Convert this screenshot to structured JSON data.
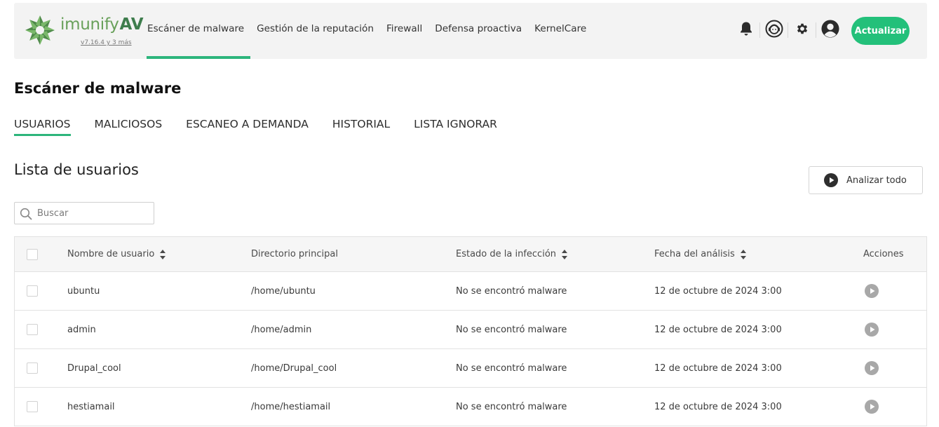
{
  "header": {
    "logo_name": "imunify",
    "logo_av": "AV",
    "version": "v7.16.4 y 3 más",
    "nav": [
      {
        "label": "Escáner de malware",
        "active": true
      },
      {
        "label": "Gestión de la reputación",
        "active": false
      },
      {
        "label": "Firewall",
        "active": false
      },
      {
        "label": "Defensa proactiva",
        "active": false
      },
      {
        "label": "KernelCare",
        "active": false
      }
    ],
    "icons": [
      "bell-icon",
      "support-agent-icon",
      "gear-icon",
      "user-avatar-icon"
    ],
    "upgrade_label": "Actualizar"
  },
  "page": {
    "title": "Escáner de malware",
    "tabs": [
      {
        "label": "USUARIOS",
        "active": true
      },
      {
        "label": "MALICIOSOS",
        "active": false
      },
      {
        "label": "ESCANEO A DEMANDA",
        "active": false
      },
      {
        "label": "HISTORIAL",
        "active": false
      },
      {
        "label": "LISTA IGNORAR",
        "active": false
      }
    ],
    "section_title": "Lista de usuarios",
    "scan_all_label": "Analizar todo",
    "search_placeholder": "Buscar"
  },
  "table": {
    "headers": {
      "username": "Nombre de usuario",
      "home_dir": "Directorio principal",
      "infection": "Estado de la infección",
      "scan_date": "Fecha del análisis",
      "actions": "Acciones"
    },
    "rows": [
      {
        "username": "ubuntu",
        "home_dir": "/home/ubuntu",
        "infection": "No se encontró malware",
        "scan_date": "12 de octubre de 2024 3:00"
      },
      {
        "username": "admin",
        "home_dir": "/home/admin",
        "infection": "No se encontró malware",
        "scan_date": "12 de octubre de 2024 3:00"
      },
      {
        "username": "Drupal_cool",
        "home_dir": "/home/Drupal_cool",
        "infection": "No se encontró malware",
        "scan_date": "12 de octubre de 2024 3:00"
      },
      {
        "username": "hestiamail",
        "home_dir": "/home/hestiamail",
        "infection": "No se encontró malware",
        "scan_date": "12 de octubre de 2024 3:00"
      }
    ]
  },
  "colors": {
    "accent": "#2db57c",
    "upgrade_button": "#23c07a",
    "logo_green": "#68a05a",
    "logo_dark_green": "#3e7d4d"
  }
}
